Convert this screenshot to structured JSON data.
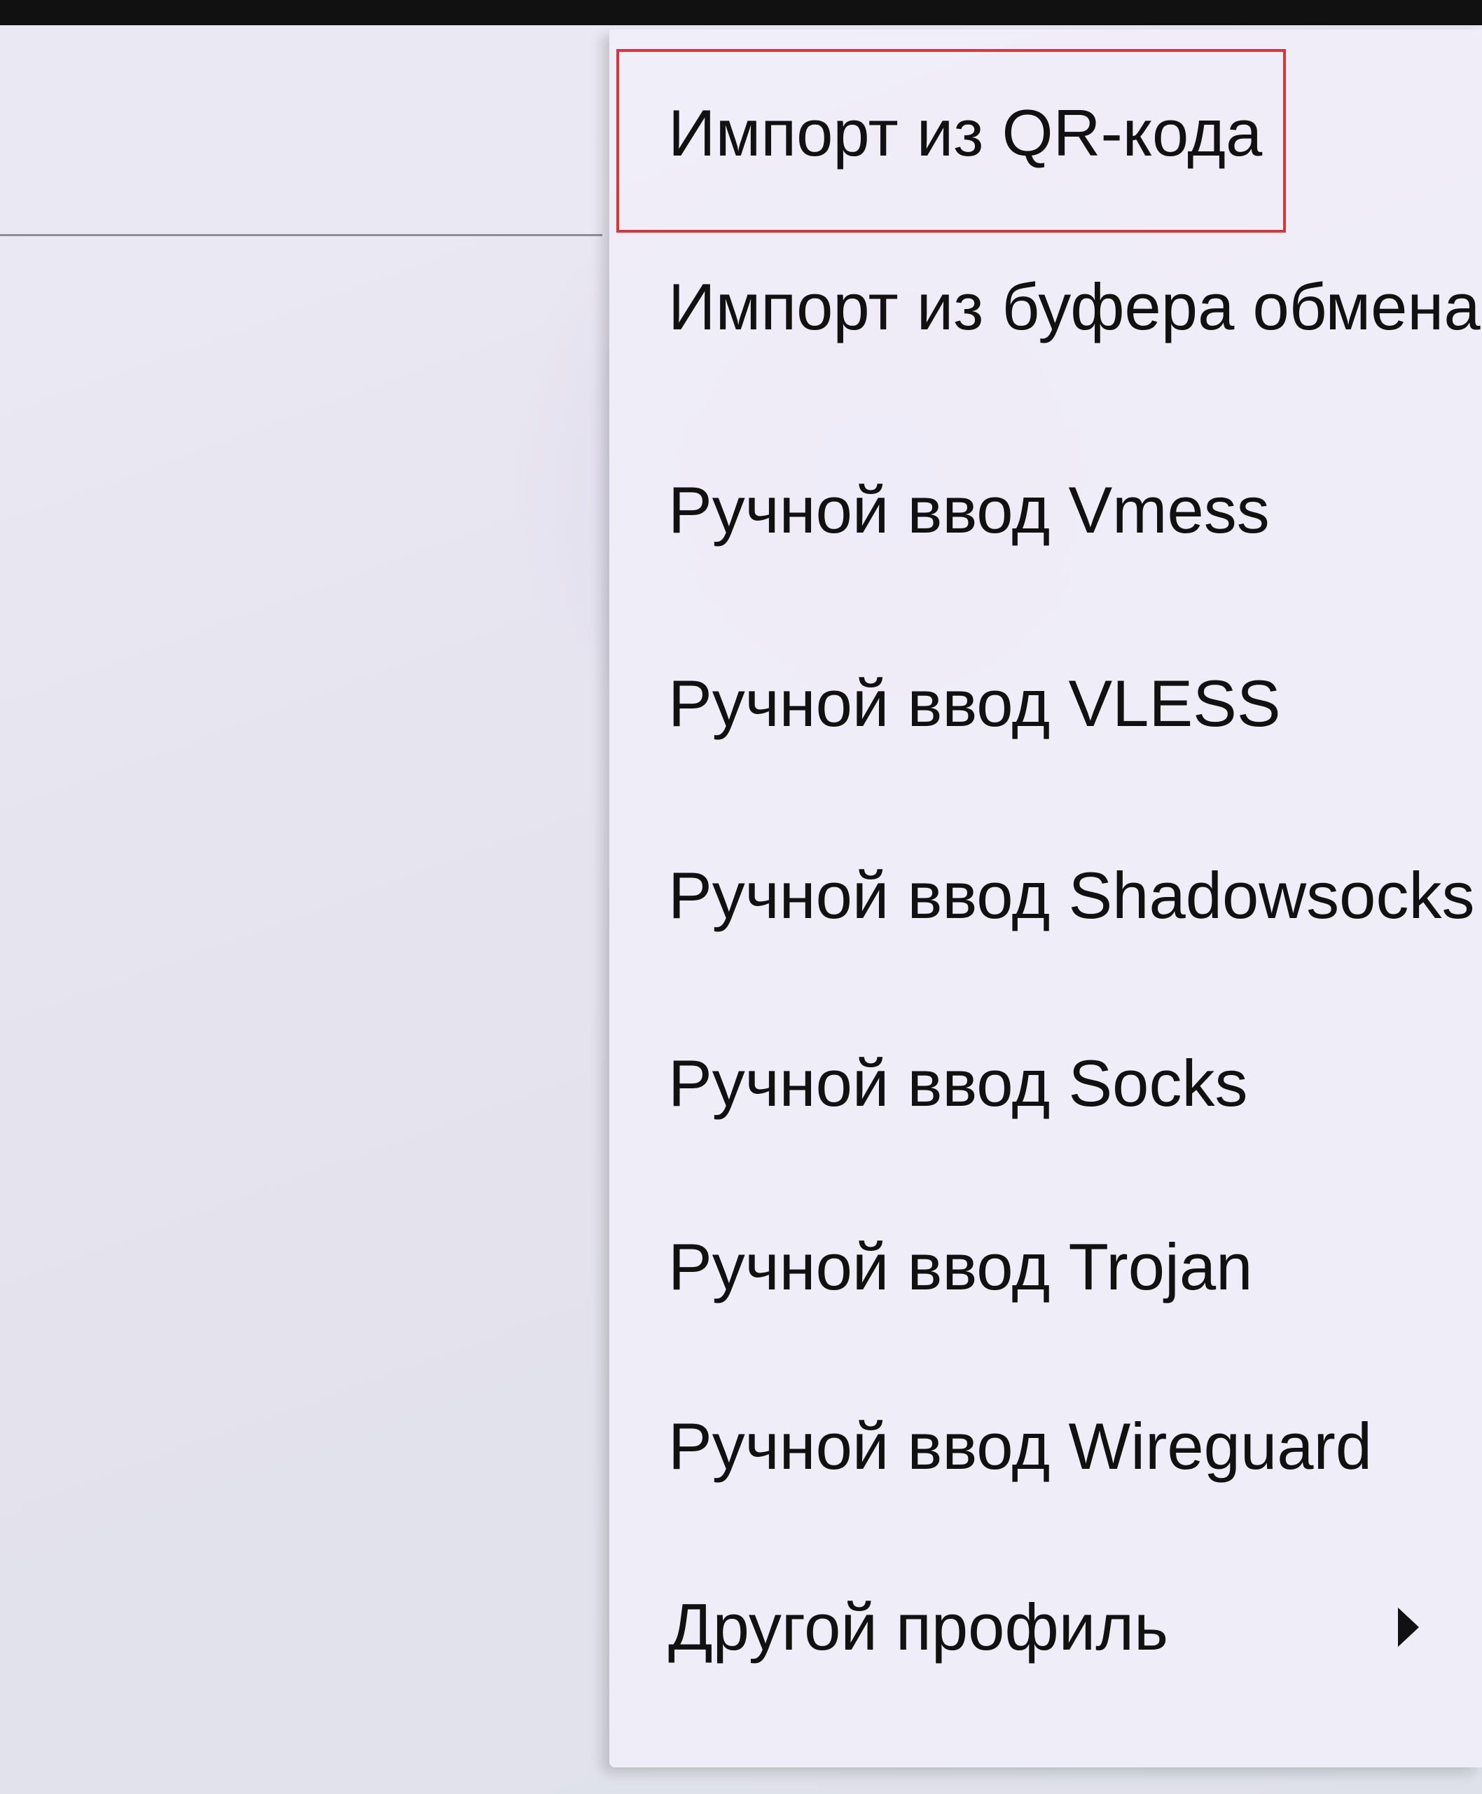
{
  "menu": {
    "items": [
      {
        "label": "Импорт из QR-кода",
        "selected": true
      },
      {
        "label": "Импорт из буфера обмена"
      },
      {
        "label": "Ручной ввод Vmess"
      },
      {
        "label": "Ручной ввод VLESS"
      },
      {
        "label": "Ручной ввод Shadowsocks"
      },
      {
        "label": "Ручной ввод Socks"
      },
      {
        "label": "Ручной ввод Trojan"
      },
      {
        "label": "Ручной ввод Wireguard"
      },
      {
        "label": "Другой профиль",
        "has_submenu": true
      }
    ]
  },
  "icons": {
    "submenu_arrow": "play-arrow-icon"
  },
  "colors": {
    "highlight": "#d7353f",
    "text": "#111111"
  }
}
